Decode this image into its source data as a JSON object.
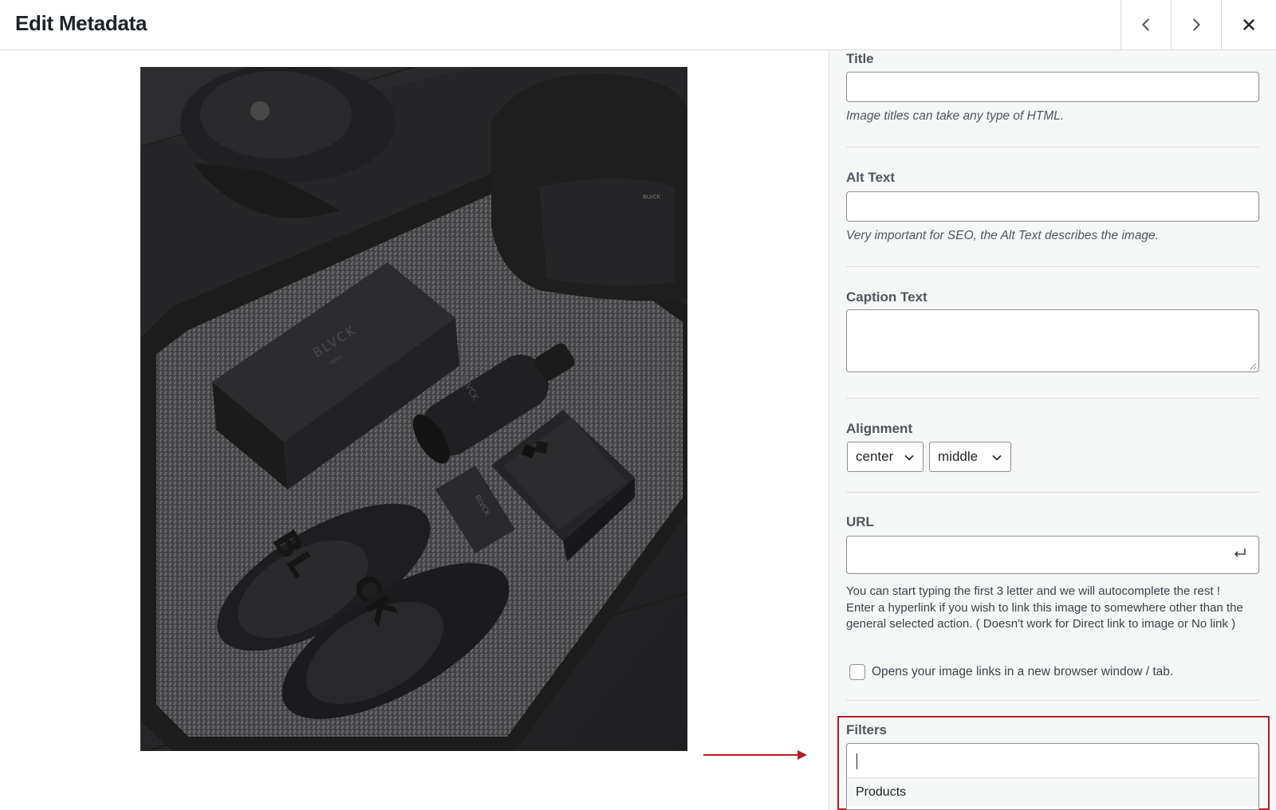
{
  "header": {
    "title": "Edit Metadata",
    "prev_icon": "chevron-left-icon",
    "next_icon": "chevron-right-icon",
    "close_icon": "close-icon"
  },
  "preview": {
    "image_description_icon": "product-photo",
    "brand_marks": [
      "BLVCK",
      "PARIS",
      "BLVCK",
      "BL",
      "CK"
    ]
  },
  "fields": {
    "title": {
      "label": "Title",
      "value": "",
      "help": "Image titles can take any type of HTML."
    },
    "alt_text": {
      "label": "Alt Text",
      "value": "",
      "help": "Very important for SEO, the Alt Text describes the image."
    },
    "caption": {
      "label": "Caption Text",
      "value": ""
    },
    "alignment": {
      "label": "Alignment",
      "horizontal": "center",
      "vertical": "middle"
    },
    "url": {
      "label": "URL",
      "value": "",
      "help": "You can start typing the first 3 letter and we will autocomplete the rest ! Enter a hyperlink if you wish to link this image to somewhere other than the general selected action. ( Doesn't work for Direct link to image or No link )",
      "new_window_label": "Opens your image links in a new browser window / tab.",
      "new_window_checked": false
    },
    "filters": {
      "label": "Filters",
      "value": "",
      "options": [
        "Products"
      ]
    }
  },
  "colors": {
    "highlight": "#b81c23",
    "panel_bg": "#f6f7f7"
  }
}
